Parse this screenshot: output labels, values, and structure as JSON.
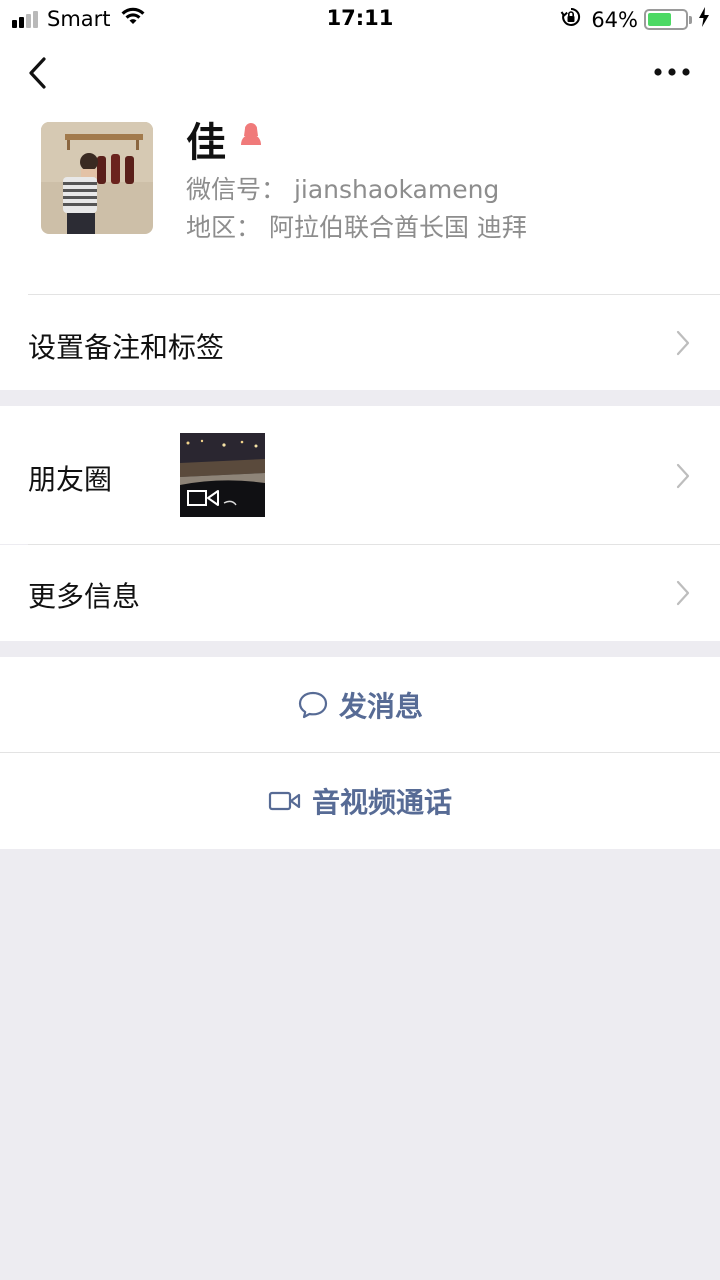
{
  "status_bar": {
    "carrier": "Smart",
    "time": "17:11",
    "battery_percent": "64%",
    "battery_level": 0.64,
    "signal_bars_active": 2,
    "signal_bars_total": 4,
    "icons": [
      "signal-icon",
      "wifi-icon",
      "rotation-lock-icon",
      "battery-icon",
      "charging-bolt-icon"
    ]
  },
  "nav": {
    "back_icon": "chevron-left-icon",
    "more_icon": "more-dots-icon"
  },
  "profile": {
    "name": "佳",
    "gender_icon": "female-icon",
    "gender_color": "#f07a7a",
    "wechat_id_line": "微信号：  jianshaokameng",
    "region_line": "地区：  阿拉伯联合酋长国 迪拜"
  },
  "rows": {
    "remark_tags": "设置备注和标签",
    "moments": "朋友圈",
    "more_info": "更多信息"
  },
  "actions": {
    "send_message": "发消息",
    "av_call": "音视频通话",
    "link_color": "#576b95"
  }
}
